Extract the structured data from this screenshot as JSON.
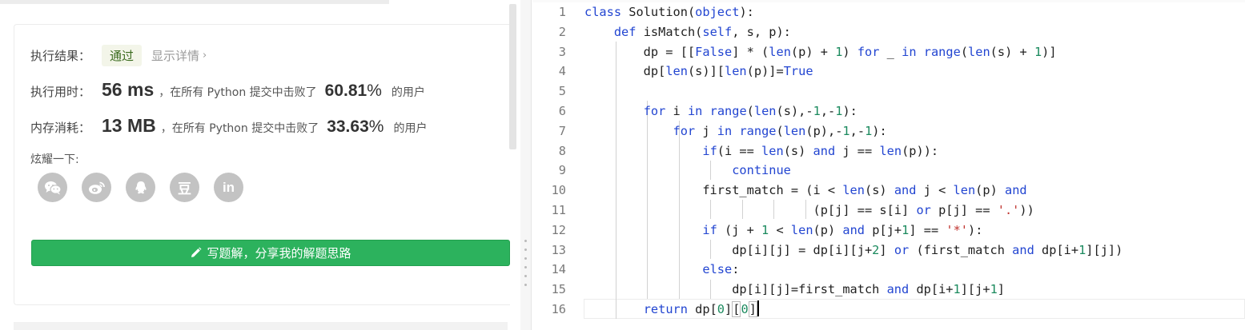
{
  "result_panel": {
    "result_label": "执行结果：",
    "status_badge": "通过",
    "details_link": "显示详情",
    "runtime": {
      "label": "执行用时：",
      "value": "56 ms",
      "middle_text": "，在所有 Python 提交中击败了",
      "percent_number": "60.81",
      "percent_sign": "%",
      "suffix": "的用户"
    },
    "memory": {
      "label": "内存消耗：",
      "value": "13 MB",
      "middle_text": "，在所有 Python 提交中击败了",
      "percent_number": "33.63",
      "percent_sign": "%",
      "suffix": "的用户"
    },
    "share_label": "炫耀一下:",
    "share_icons": [
      "wechat-icon",
      "weibo-icon",
      "qq-icon",
      "douban-icon",
      "linkedin-icon"
    ],
    "douban_glyph": "豆",
    "linkedin_glyph": "in",
    "write_button_label": "写题解，分享我的解题思路"
  },
  "editor": {
    "line_numbers": [
      "1",
      "2",
      "3",
      "4",
      "5",
      "6",
      "7",
      "8",
      "9",
      "10",
      "11",
      "12",
      "13",
      "14",
      "15",
      "16"
    ],
    "code_lines": [
      "class Solution(object):",
      "    def isMatch(self, s, p):",
      "        dp = [[False] * (len(p) + 1) for _ in range(len(s) + 1)]",
      "        dp[len(s)][len(p)]=True",
      "",
      "        for i in range(len(s),-1,-1):",
      "            for j in range(len(p),-1,-1):",
      "                if(i == len(s) and j == len(p)):",
      "                    continue",
      "                first_match = (i < len(s) and j < len(p) and",
      "                               (p[j] == s[i] or p[j] == '.'))",
      "                if (j + 1 < len(p) and p[j+1] == '*'):",
      "                    dp[i][j] = dp[i][j+2] or (first_match and dp[i+1][j])",
      "                else:",
      "                    dp[i][j]=first_match and dp[i+1][j+1]",
      "        return dp[0][0]"
    ],
    "active_line": "16"
  },
  "colors": {
    "accent_green": "#2cb25d",
    "keyword_blue": "#2245d1",
    "number_green": "#1b8a5e",
    "string_red": "#c0342f"
  }
}
